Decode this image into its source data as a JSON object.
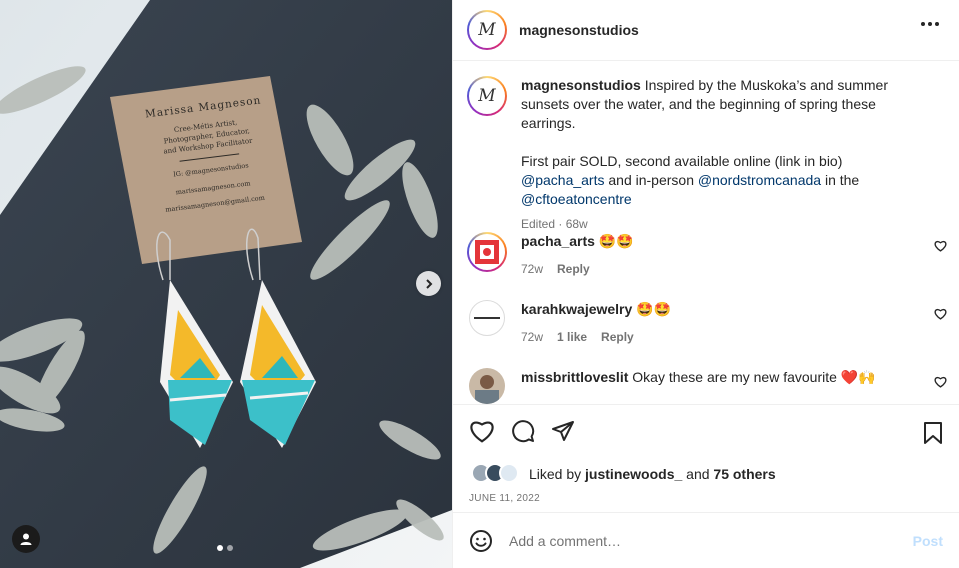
{
  "post": {
    "username": "magnesonstudios",
    "avatar_letter": "M"
  },
  "card": {
    "name": "Marissa Magneson",
    "line1": "Cree-Métis Artist,",
    "line2": "Photographer, Educator,",
    "line3": "and Workshop Facilitator",
    "ig": "IG: @magnesonstudios",
    "web": "marissamagneson.com",
    "email": "marissamagneson@gmail.com"
  },
  "caption": {
    "username": "magnesonstudios",
    "text1": "Inspired by the Muskoka’s and summer sunsets over the water, and the beginning of spring these earrings.",
    "text2_a": "First pair SOLD, second available online (link in bio)",
    "mention1": "@pacha_arts",
    "text2_b": "and in-person",
    "mention2": "@nordstromcanada",
    "text2_c": "in the",
    "mention3": "@cftoeatoncentre",
    "edited": "Edited",
    "time": "68w"
  },
  "comments": [
    {
      "username": "pacha_arts",
      "text": "🤩🤩",
      "time": "72w",
      "likes": "",
      "reply": "Reply"
    },
    {
      "username": "karahkwajewelry",
      "text": "🤩🤩",
      "time": "72w",
      "likes": "1 like",
      "reply": "Reply"
    },
    {
      "username": "missbrittloveslit",
      "text": "Okay these are my new favourite ❤️🙌",
      "time": "",
      "likes": "",
      "reply": ""
    }
  ],
  "likes": {
    "prefix": "Liked by",
    "user": "justinewoods_",
    "and": "and",
    "others": "75 others"
  },
  "date": "JUNE 11, 2022",
  "add_comment": {
    "placeholder": "Add a comment…",
    "post_label": "Post"
  },
  "colors": {
    "mention": "#00376b",
    "post_disabled": "#c0dffd",
    "muted": "#737373"
  }
}
